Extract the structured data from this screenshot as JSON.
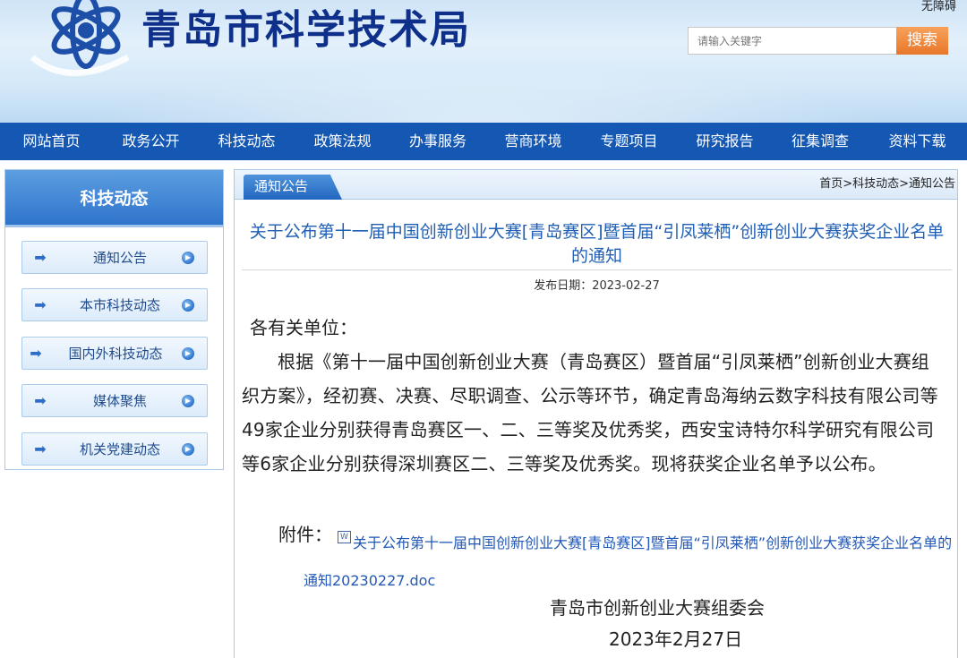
{
  "header": {
    "site_title": "青岛市科学技术局",
    "accessibility": "无障碍",
    "search_placeholder": "请输入关键字",
    "search_button": "搜索"
  },
  "nav": {
    "items": [
      "网站首页",
      "政务公开",
      "科技动态",
      "政策法规",
      "办事服务",
      "营商环境",
      "专题项目",
      "研究报告",
      "征集调查",
      "资料下载"
    ]
  },
  "sidebar": {
    "title": "科技动态",
    "items": [
      "通知公告",
      "本市科技动态",
      "国内外科技动态",
      "媒体聚焦",
      "机关党建动态"
    ]
  },
  "main": {
    "tab": "通知公告",
    "breadcrumb": "首页>科技动态>通知公告",
    "title": "关于公布第十一届中国创新创业大赛[青岛赛区]暨首届“引凤莱栖”创新创业大赛获奖企业名单的通知",
    "pub_date": "发布日期：2023-02-27",
    "salutation": "各有关单位：",
    "body": "根据《第十一届中国创新创业大赛（青岛赛区）暨首届“引凤莱栖”创新创业大赛组织方案》，经初赛、决赛、尽职调查、公示等环节，确定青岛海纳云数字科技有限公司等49家企业分别获得青岛赛区一、二、三等奖及优秀奖，西安宝诗特尔科学研究有限公司等6家企业分别获得深圳赛区二、三等奖及优秀奖。现将获奖企业名单予以公布。",
    "attachment_label": "附件：",
    "attachment_link": "关于公布第十一届中国创新创业大赛[青岛赛区]暨首届“引凤莱栖”创新创业大赛获奖企业名单的通知20230227.doc",
    "sign_org": "青岛市创新创业大赛组委会",
    "sign_date": "2023年2月27日"
  },
  "colors": {
    "nav_bg": "#1458b4",
    "title_blue": "#0e2f8a",
    "link_blue": "#2258b8",
    "search_orange": "#e8772a"
  }
}
